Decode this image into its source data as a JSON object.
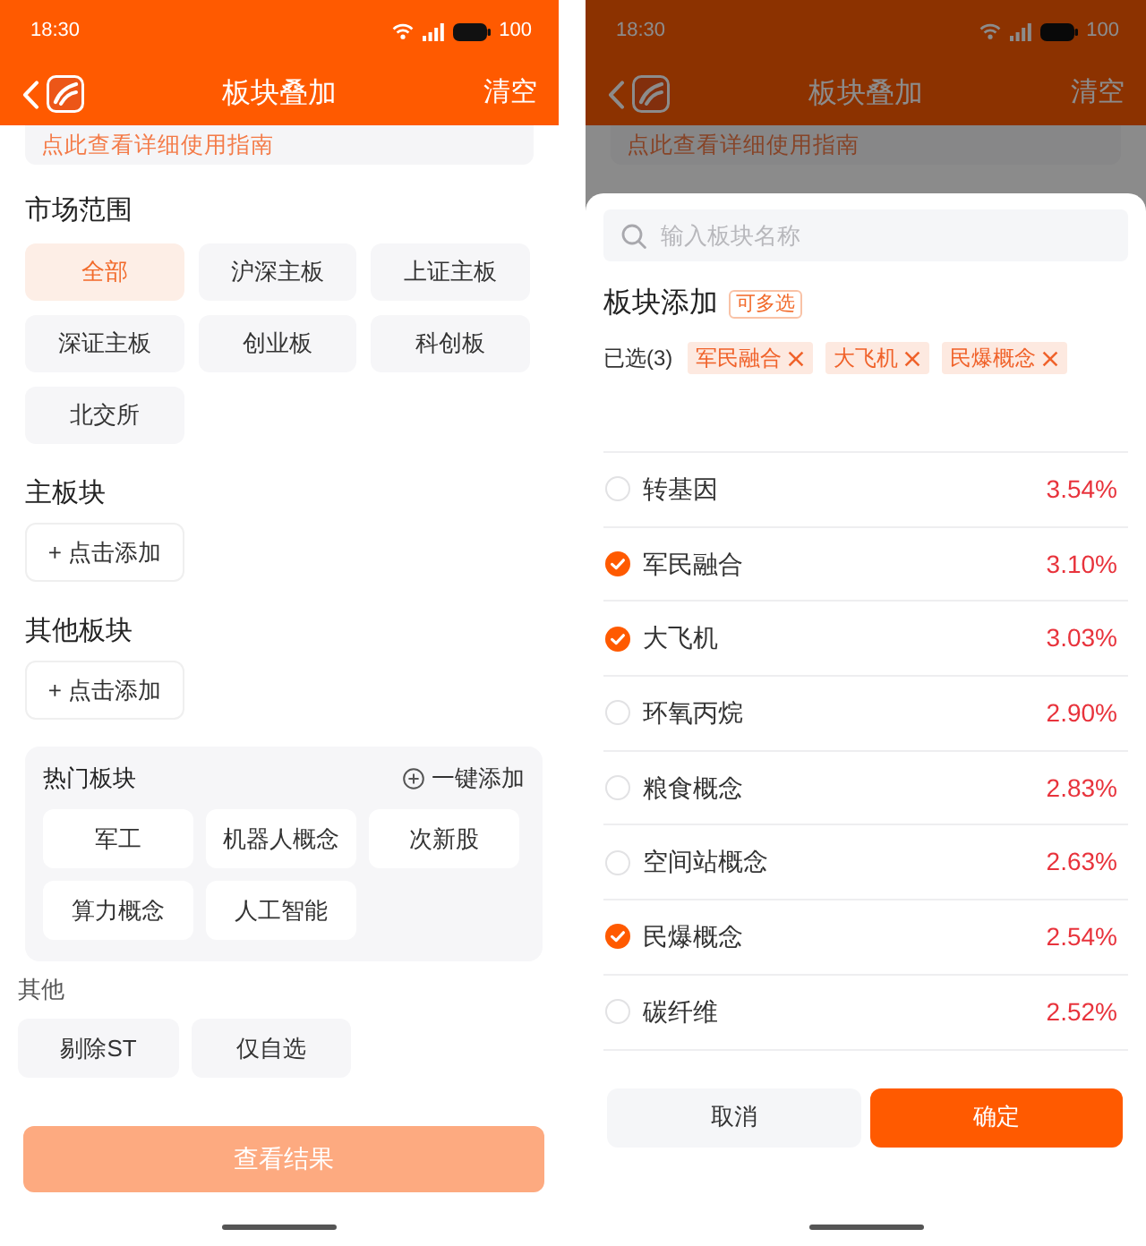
{
  "screens": [
    {
      "dimmed": false,
      "status_bar": {
        "time": "18:30",
        "battery": "100"
      },
      "nav_bar": {
        "title": "板块叠加",
        "action": "清空"
      },
      "guide_link": "点此查看详细使用指南",
      "filters": {
        "market_range": {
          "title": "市场范围",
          "options": [
            {
              "label": "全部",
              "selected": true
            },
            {
              "label": "沪深主板",
              "selected": false
            },
            {
              "label": "上证主板",
              "selected": false
            },
            {
              "label": "深证主板",
              "selected": false
            },
            {
              "label": "创业板",
              "selected": false
            },
            {
              "label": "科创板",
              "selected": false
            },
            {
              "label": "北交所",
              "selected": false
            }
          ]
        },
        "main_sector": {
          "title": "主板块",
          "add_button": "+ 点击添加"
        },
        "other_sectors": {
          "title": "其他板块",
          "add_button": "+ 点击添加"
        },
        "hot_sectors": {
          "title": "热门板块",
          "add_all": "一键添加",
          "items": [
            "军工",
            "机器人概念",
            "次新股",
            "算力概念",
            "人工智能"
          ]
        },
        "others": {
          "title": "其他",
          "options": [
            {
              "label": "剔除ST",
              "selected": false
            },
            {
              "label": "仅自选",
              "selected": false
            }
          ]
        },
        "submit": {
          "label": "查看结果",
          "disabled": true
        }
      }
    },
    {
      "dimmed": true,
      "status_bar": {
        "time": "18:30",
        "battery": "100"
      },
      "nav_bar": {
        "title": "板块叠加",
        "action": "清空"
      },
      "guide_link": "点此查看详细使用指南",
      "sheet": {
        "search": {
          "placeholder": "输入板块名称"
        },
        "title": "板块添加",
        "badge": "可多选",
        "selected_label": "已选(3)",
        "selected_chips": [
          "军民融合",
          "大飞机",
          "民爆概念"
        ],
        "sectors": [
          {
            "name": "转基因",
            "change": "3.54%",
            "checked": false
          },
          {
            "name": "军民融合",
            "change": "3.10%",
            "checked": true
          },
          {
            "name": "大飞机",
            "change": "3.03%",
            "checked": true
          },
          {
            "name": "环氧丙烷",
            "change": "2.90%",
            "checked": false
          },
          {
            "name": "粮食概念",
            "change": "2.83%",
            "checked": false
          },
          {
            "name": "空间站概念",
            "change": "2.63%",
            "checked": false
          },
          {
            "name": "民爆概念",
            "change": "2.54%",
            "checked": true
          },
          {
            "name": "碳纤维",
            "change": "2.52%",
            "checked": false
          }
        ],
        "buttons": {
          "cancel": "取消",
          "confirm": "确定"
        }
      }
    }
  ]
}
